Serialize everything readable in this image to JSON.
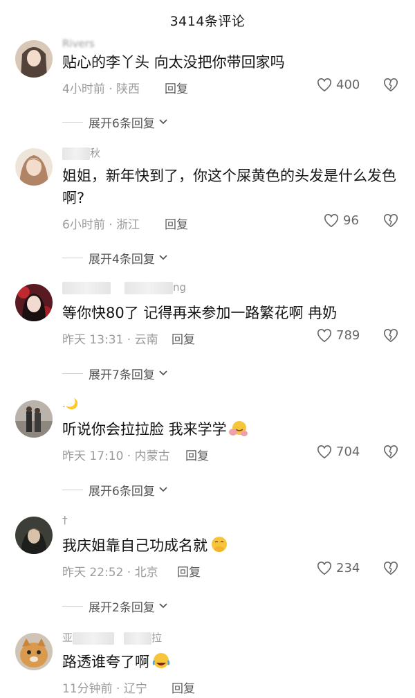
{
  "header": {
    "title": "3414条评论"
  },
  "comments": [
    {
      "username": "Rivers",
      "text": "贴心的李丫头 向太没把你带回家吗",
      "time": "4小时前 · 陕西",
      "reply_label": "回复",
      "likes": "400",
      "expand": "展开6条回复"
    },
    {
      "username": "秋",
      "text": "姐姐，新年快到了，你这个屎黄色的头发是什么发色啊?",
      "time": "6小时前 · 浙江",
      "reply_label": "回复",
      "likes": "96",
      "expand": "展开4条回复"
    },
    {
      "username": "ng",
      "text": "等你快80了 记得再来参加一路繁花啊 冉奶",
      "time": "昨天 13:31 · 云南",
      "reply_label": "回复",
      "likes": "789",
      "expand": "展开7条回复"
    },
    {
      "username": ".🌙",
      "text": "听说你会拉拉脸 我来学学",
      "time": "昨天 17:10 · 内蒙古",
      "reply_label": "回复",
      "likes": "704",
      "expand": "展开6条回复"
    },
    {
      "username": "†",
      "text": "我庆姐靠自己功成名就",
      "time": "昨天 22:52 · 北京",
      "reply_label": "回复",
      "likes": "234",
      "expand": "展开2条回复"
    },
    {
      "username_parts": [
        "亚",
        "拉"
      ],
      "text": "路透谁夸了啊",
      "time": "11分钟前 · 辽宁",
      "reply_label": "回复"
    }
  ],
  "icons": {
    "like": "heart-outline-icon",
    "dislike": "broken-heart-icon",
    "expand": "chevron-down-icon"
  },
  "colors": {
    "meta_text": "#9b9b9b",
    "body_text": "#141414",
    "reply_text": "#5c5c5c"
  }
}
